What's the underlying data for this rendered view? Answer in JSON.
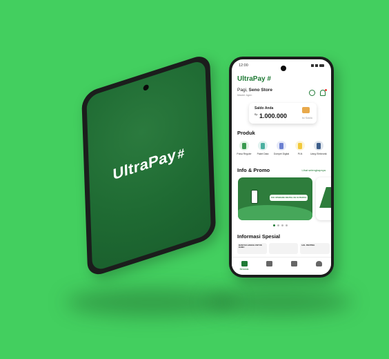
{
  "brand": {
    "name": "UltraPay",
    "mark": "#",
    "green": "#1f7a35",
    "background": "#43cf5f"
  },
  "status_bar": {
    "time": "12:00"
  },
  "greeting": {
    "prefix": "Pagi,",
    "name": "Seno Store",
    "role": "Master Agen"
  },
  "balance": {
    "label": "Saldo Anda",
    "currency": "Rp",
    "amount": "1.000.000",
    "top_up": "Isi Saldo"
  },
  "products": {
    "title": "Produk",
    "items": [
      {
        "label": "Pulsa Reguler",
        "icon": "sim-card-icon",
        "color": "#3a9a4f"
      },
      {
        "label": "Paket Data",
        "icon": "data-icon",
        "color": "#4bb0a0"
      },
      {
        "label": "Dompet Digital",
        "icon": "wallet-icon",
        "color": "#6a7fd1"
      },
      {
        "label": "PLN",
        "icon": "lightning-icon",
        "color": "#f2c93a"
      },
      {
        "label": "Uang Elektronik",
        "icon": "card-icon",
        "color": "#3d5e8a"
      }
    ]
  },
  "promo": {
    "title": "Info & Promo",
    "see_all": "Lihat selengkapnya",
    "banner_text": "YUK UPGRADE DIGITAL KE ULTRAPAY",
    "active_index": 0,
    "count": 4
  },
  "special": {
    "title": "Informasi Spesial",
    "cards": [
      "BANYAK HADIAH UNTUK KAMU",
      "",
      "HAL PENTING"
    ]
  },
  "nav": {
    "items": [
      {
        "label": "Beranda",
        "icon": "home-icon",
        "active": true
      },
      {
        "label": "",
        "icon": "transaction-icon",
        "active": false
      },
      {
        "label": "",
        "icon": "report-icon",
        "active": false
      },
      {
        "label": "",
        "icon": "profile-icon",
        "active": false
      }
    ]
  }
}
